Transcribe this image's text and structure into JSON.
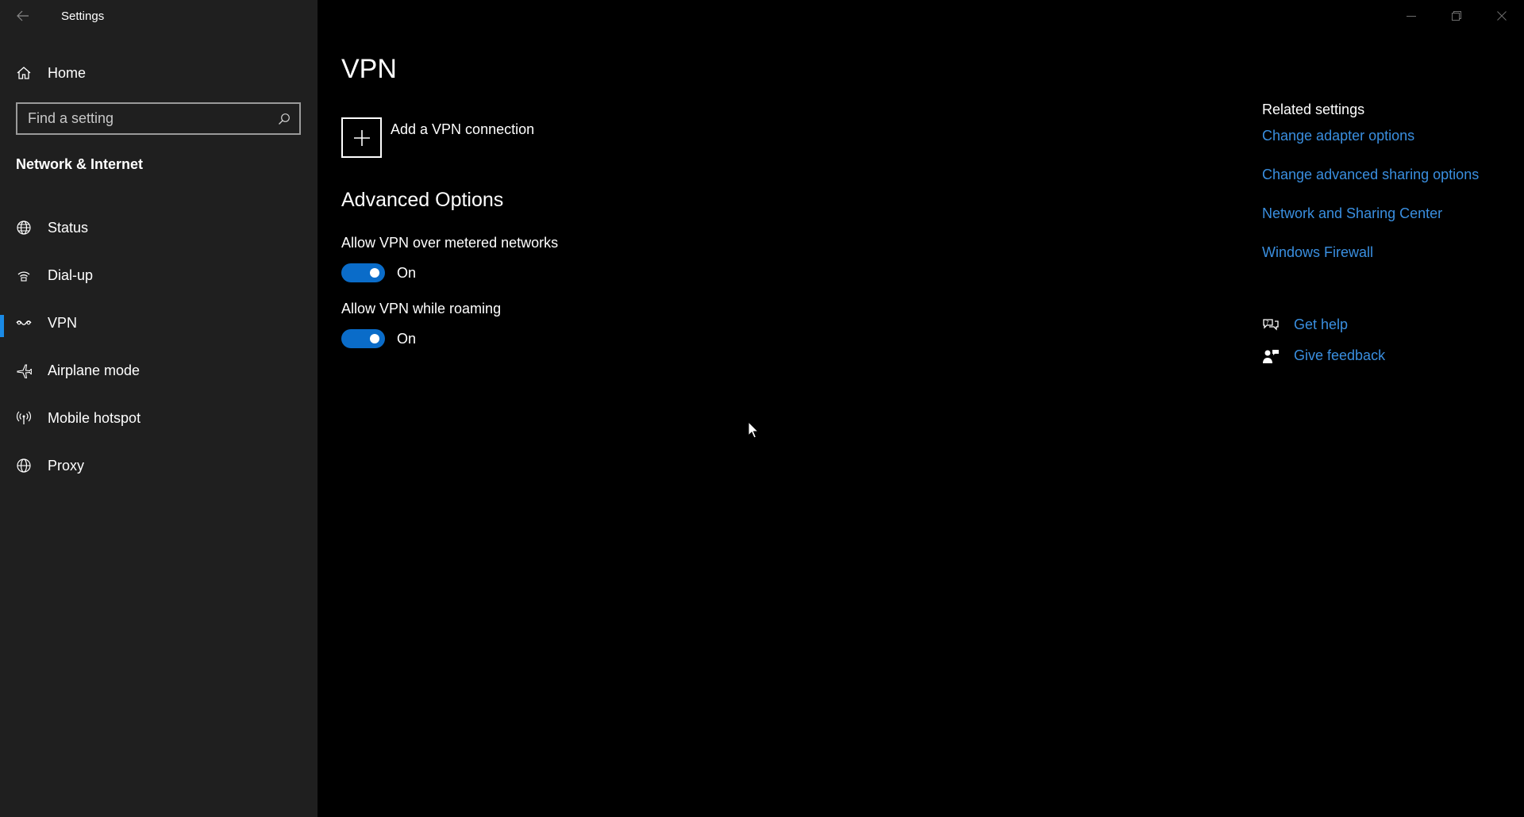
{
  "window": {
    "title": "Settings"
  },
  "sidebar": {
    "home_label": "Home",
    "search_placeholder": "Find a setting",
    "section_title": "Network & Internet",
    "items": [
      {
        "label": "Status",
        "icon": "globe-status-icon"
      },
      {
        "label": "Dial-up",
        "icon": "dialup-icon"
      },
      {
        "label": "VPN",
        "icon": "vpn-icon",
        "selected": true
      },
      {
        "label": "Airplane mode",
        "icon": "airplane-icon"
      },
      {
        "label": "Mobile hotspot",
        "icon": "hotspot-icon"
      },
      {
        "label": "Proxy",
        "icon": "globe-icon"
      }
    ]
  },
  "main": {
    "title": "VPN",
    "add_connection_label": "Add a VPN connection",
    "advanced_title": "Advanced Options",
    "options": [
      {
        "label": "Allow VPN over metered networks",
        "state": "On",
        "enabled": true
      },
      {
        "label": "Allow VPN while roaming",
        "state": "On",
        "enabled": true
      }
    ]
  },
  "related": {
    "title": "Related settings",
    "links": [
      "Change adapter options",
      "Change advanced sharing options",
      "Network and Sharing Center",
      "Windows Firewall"
    ]
  },
  "help": {
    "get_help": "Get help",
    "give_feedback": "Give feedback"
  },
  "colors": {
    "accent": "#0a6cc9",
    "link": "#3a8fe0",
    "sidebar_bg": "#1f1f1f",
    "main_bg": "#000000"
  }
}
